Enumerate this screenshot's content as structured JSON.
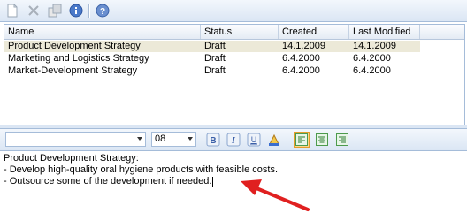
{
  "toolbar": {
    "icons": [
      "new-document-icon",
      "delete-icon",
      "copy-icon",
      "info-icon",
      "help-icon"
    ]
  },
  "grid": {
    "columns": [
      "Name",
      "Status",
      "Created",
      "Last Modified"
    ],
    "rows": [
      {
        "name": "Product Development Strategy",
        "status": "Draft",
        "created": "14.1.2009",
        "modified": "14.1.2009"
      },
      {
        "name": "Marketing and Logistics Strategy",
        "status": "Draft",
        "created": "6.4.2000",
        "modified": "6.4.2000"
      },
      {
        "name": "Market-Development Strategy",
        "status": "Draft",
        "created": "6.4.2000",
        "modified": "6.4.2000"
      }
    ],
    "selected_row": 0
  },
  "format_bar": {
    "font_name": "",
    "font_size": "08",
    "bold": "B",
    "italic": "I",
    "underline": "U"
  },
  "editor": {
    "lines": [
      "Product Development Strategy:",
      "- Develop high-quality oral hygiene products with feasible costs.",
      "- Outsource some of the development if needed."
    ]
  },
  "colors": {
    "annotation_arrow": "#e02020",
    "selection": "#ece9d8",
    "toolbar": "#dbe6f4"
  }
}
